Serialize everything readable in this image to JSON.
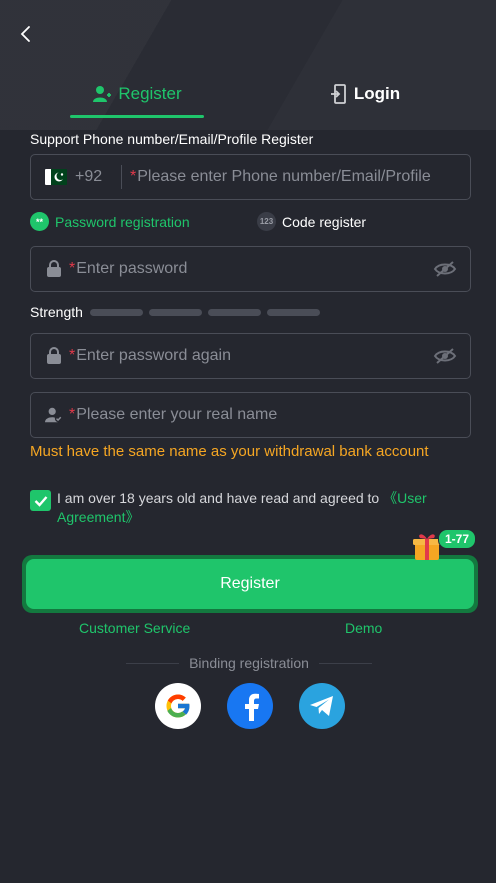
{
  "tabs": {
    "register": "Register",
    "login": "Login"
  },
  "form": {
    "support_label": "Support Phone number/Email/Profile Register",
    "country_code": "+92",
    "phone_placeholder": "Please enter Phone number/Email/Profile",
    "modes": {
      "password": "Password registration",
      "password_icon": "**",
      "code": "Code register",
      "code_icon": "123"
    },
    "password_placeholder": "Enter password",
    "strength_label": "Strength",
    "password_again_placeholder": "Enter password again",
    "name_placeholder": "Please enter your real name",
    "name_warning": "Must have the same name as your withdrawal bank account",
    "agreement_text": "I am over 18 years old and have read and agreed to ",
    "agreement_link": "《User Agreement》",
    "agreement_checked": true,
    "required_mark": "*"
  },
  "register_button": "Register",
  "promo_badge": "1-77",
  "links": {
    "customer_service": "Customer Service",
    "demo": "Demo"
  },
  "binding_label": "Binding registration",
  "socials": [
    "google-icon",
    "facebook-icon",
    "telegram-icon"
  ],
  "colors": {
    "accent": "#1fc56b",
    "warning": "#f5a623",
    "background": "#25272f"
  }
}
